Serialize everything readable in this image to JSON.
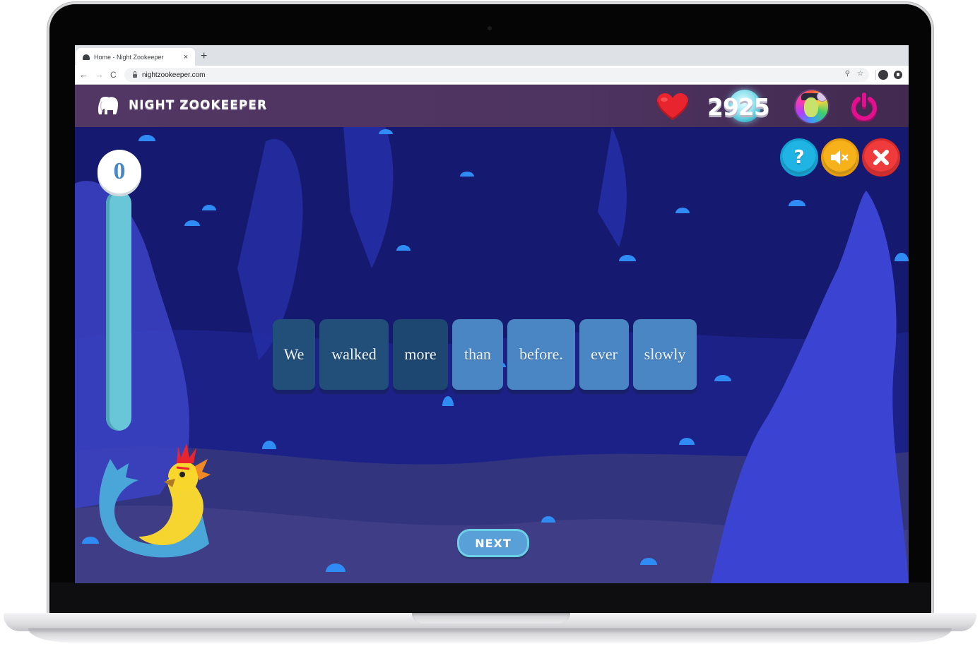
{
  "browser": {
    "tab_title": "Home - Night Zookeeper",
    "tab_close_glyph": "×",
    "new_tab_glyph": "+",
    "url": "nightzookeeper.com",
    "back_glyph": "←",
    "forward_glyph": "→",
    "reload_glyph": "C",
    "zoom_glyph": "⚲",
    "bookmark_glyph": "☆"
  },
  "header": {
    "logo_text": "NIGHT ZOOKEEPER",
    "score": "2925",
    "heart_color": "#e8242e",
    "power_color": "#e0108e"
  },
  "game": {
    "progress_value": "0",
    "progress_fraction": 0,
    "buttons": {
      "help_glyph": "?",
      "help_color": "#1fb4e3",
      "mute_color": "#f6b11b",
      "close_color": "#ef3b3b"
    },
    "words": [
      {
        "text": "We",
        "state": "placed"
      },
      {
        "text": "walked",
        "state": "placed"
      },
      {
        "text": "more",
        "state": "placed"
      },
      {
        "text": "than",
        "state": "loose"
      },
      {
        "text": "before.",
        "state": "loose"
      },
      {
        "text": "ever",
        "state": "loose"
      },
      {
        "text": "slowly",
        "state": "loose"
      }
    ],
    "next_label": "NEXT"
  }
}
